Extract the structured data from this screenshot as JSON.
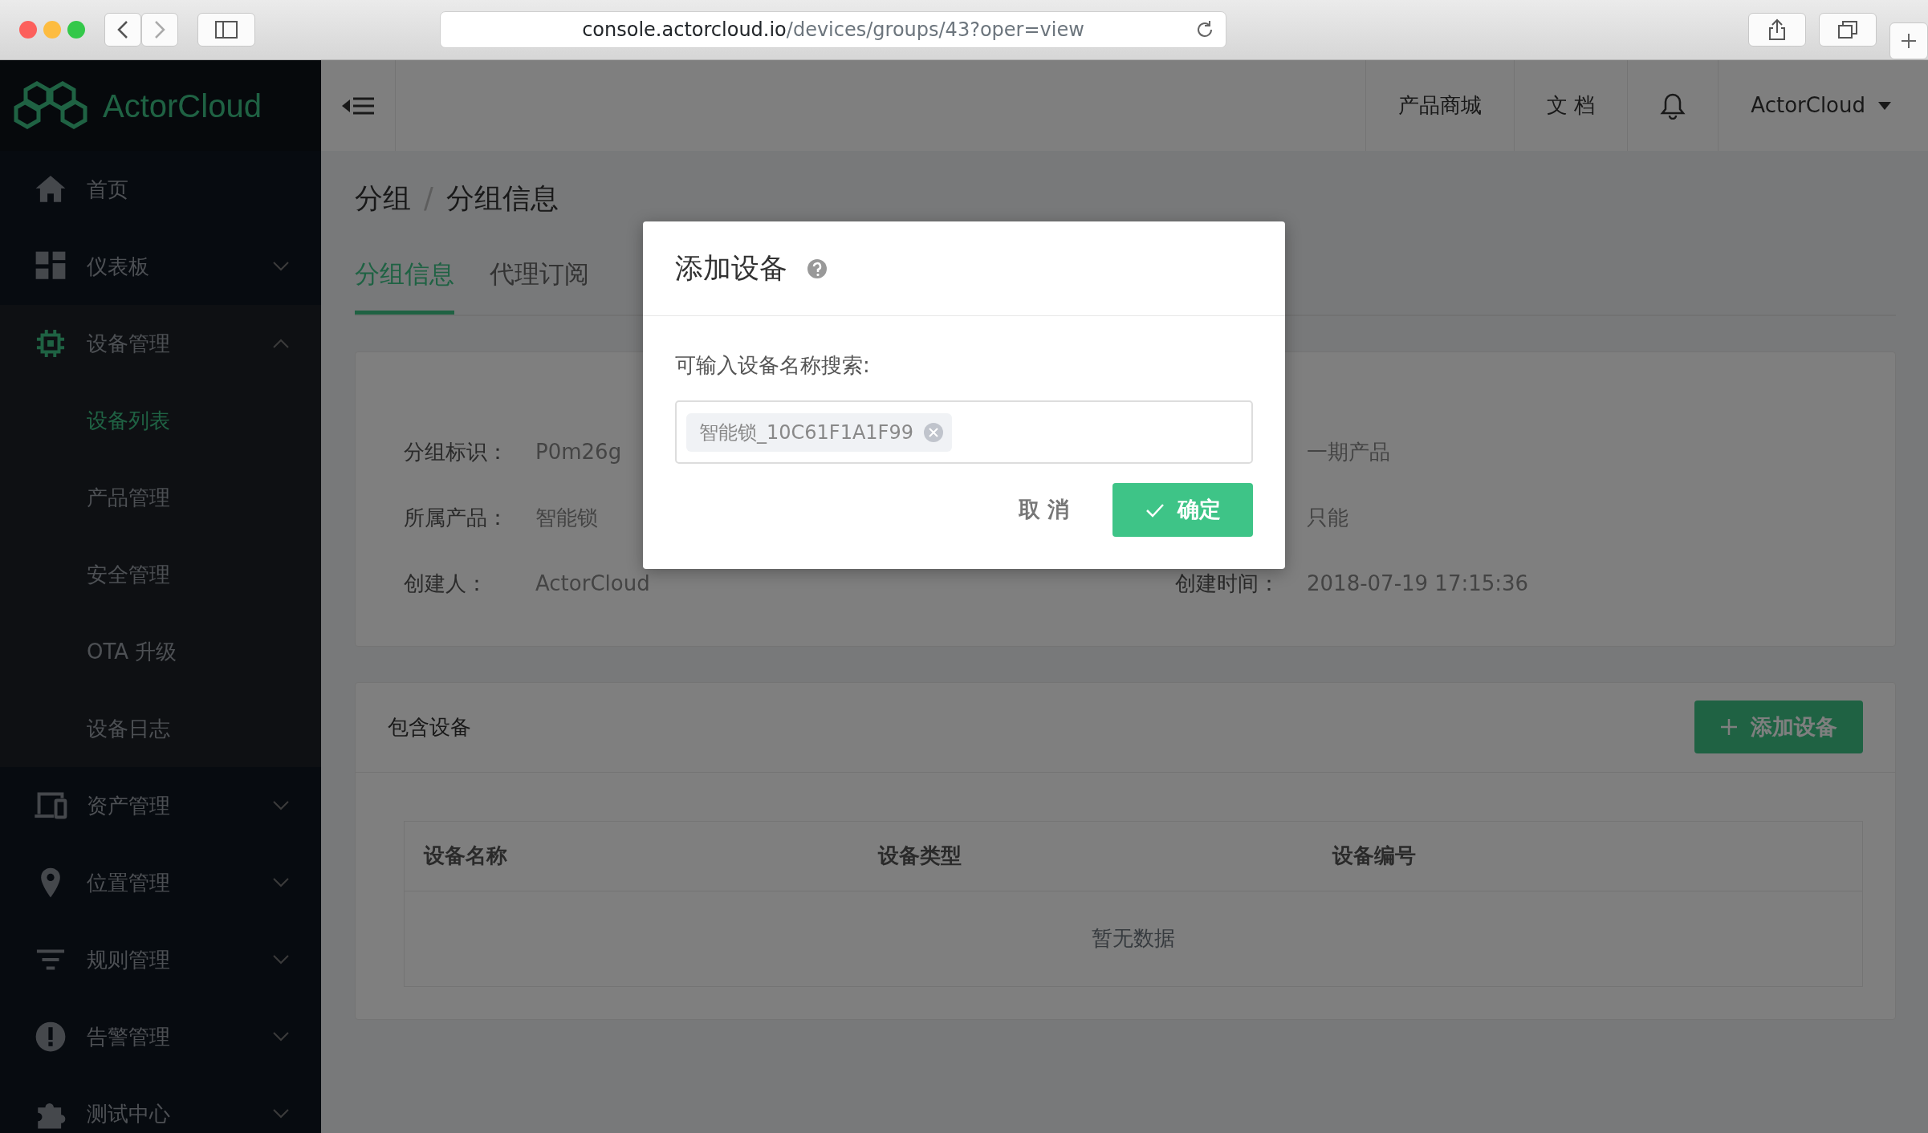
{
  "browser": {
    "url_host": "console.actorcloud.io",
    "url_path": "/devices/groups/43?oper=view"
  },
  "sidebar": {
    "logo": "ActorCloud",
    "items": [
      {
        "label": "首页",
        "kind": "link"
      },
      {
        "label": "仪表板",
        "kind": "group",
        "expanded": false
      },
      {
        "label": "设备管理",
        "kind": "group",
        "expanded": true,
        "children": [
          {
            "label": "设备列表",
            "selected": true
          },
          {
            "label": "产品管理",
            "selected": false
          },
          {
            "label": "安全管理",
            "selected": false
          },
          {
            "label": "OTA 升级",
            "selected": false
          },
          {
            "label": "设备日志",
            "selected": false
          }
        ]
      },
      {
        "label": "资产管理",
        "kind": "group",
        "expanded": false
      },
      {
        "label": "位置管理",
        "kind": "group",
        "expanded": false
      },
      {
        "label": "规则管理",
        "kind": "group",
        "expanded": false
      },
      {
        "label": "告警管理",
        "kind": "group",
        "expanded": false
      },
      {
        "label": "测试中心",
        "kind": "group",
        "expanded": false
      }
    ]
  },
  "header": {
    "links": [
      "产品商城",
      "文 档"
    ],
    "user": "ActorCloud"
  },
  "breadcrumb": {
    "items": [
      "分组",
      "分组信息"
    ],
    "separator": "/"
  },
  "tabs": [
    {
      "label": "分组信息",
      "selected": true
    },
    {
      "label": "代理订阅",
      "selected": false
    }
  ],
  "info_rows": [
    {
      "left": {
        "label": "分组标识：",
        "value": "P0m26g"
      },
      "right": {
        "value": "一期产品"
      }
    },
    {
      "left": {
        "label": "所属产品：",
        "value": "智能锁"
      },
      "right": {
        "value": "只能"
      }
    },
    {
      "left": {
        "label": "创建人：",
        "value": "ActorCloud"
      },
      "right": {
        "label": "创建时间：",
        "value": "2018-07-19 17:15:36"
      }
    }
  ],
  "devices": {
    "title": "包含设备",
    "add_button": "添加设备",
    "columns": [
      "设备名称",
      "设备类型",
      "设备编号"
    ],
    "empty_text": "暂无数据"
  },
  "dialog": {
    "title": "添加设备",
    "label": "可输入设备名称搜索:",
    "tags": [
      "智能锁_10C61F1A1F99"
    ],
    "cancel": "取 消",
    "confirm": "确定"
  }
}
